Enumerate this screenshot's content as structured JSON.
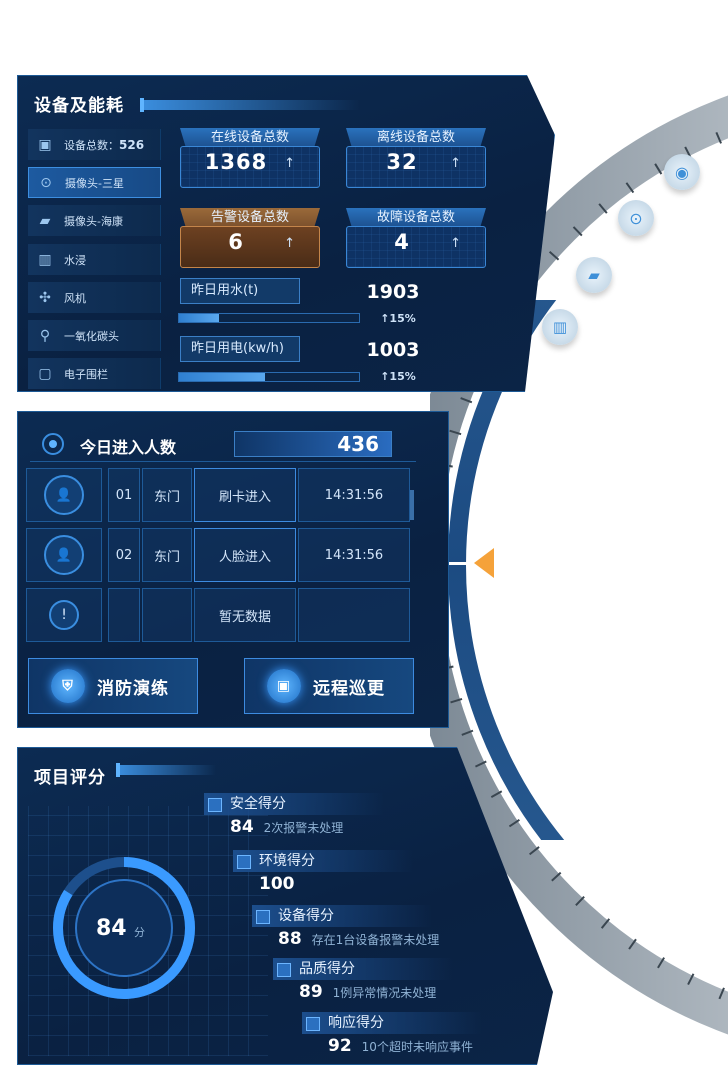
{
  "device_panel": {
    "title": "设备及能耗",
    "device_list": [
      {
        "label": "设备总数：",
        "value": "526",
        "icon": "device-icon"
      },
      {
        "label": "摄像头-三星",
        "icon": "camera-icon"
      },
      {
        "label": "摄像头-海康",
        "icon": "cctv-icon"
      },
      {
        "label": "水浸",
        "icon": "water-icon"
      },
      {
        "label": "风机",
        "icon": "fan-icon"
      },
      {
        "label": "一氧化碳头",
        "icon": "co-sensor-icon"
      },
      {
        "label": "电子围栏",
        "icon": "fence-icon"
      }
    ],
    "stats": [
      {
        "label": "在线设备总数",
        "value": "1368"
      },
      {
        "label": "离线设备总数",
        "value": "32"
      },
      {
        "label": "告警设备总数",
        "value": "6"
      },
      {
        "label": "故障设备总数",
        "value": "4"
      }
    ],
    "up_arrow": "↑",
    "water": {
      "label": "昨日用水(t)",
      "value": "1903",
      "change": "↑15%",
      "level": 0.22
    },
    "power": {
      "label": "昨日用电(kw/h)",
      "value": "1003",
      "change": "↑15%",
      "level": 0.48
    }
  },
  "entry_panel": {
    "title": "今日进入人数",
    "count": "436",
    "rows": [
      {
        "no": "01",
        "gate": "东门",
        "method": "刷卡进入",
        "time": "14:31:56"
      },
      {
        "no": "02",
        "gate": "东门",
        "method": "人脸进入",
        "time": "14:31:56"
      },
      {
        "no": "",
        "gate": "",
        "method": "暂无数据",
        "time": ""
      }
    ],
    "buttons": {
      "fire_drill": "消防演练",
      "remote_patrol": "远程巡更"
    }
  },
  "score_panel": {
    "title": "项目评分",
    "total": "84",
    "unit": "分",
    "items": [
      {
        "name": "安全得分",
        "score": "84",
        "note": "2次报警未处理"
      },
      {
        "name": "环境得分",
        "score": "100",
        "note": ""
      },
      {
        "name": "设备得分",
        "score": "88",
        "note": "存在1台设备报警未处理"
      },
      {
        "name": "品质得分",
        "score": "89",
        "note": "1例异常情况未处理"
      },
      {
        "name": "响应得分",
        "score": "92",
        "note": "10个超时未响应事件"
      }
    ]
  },
  "colors": {
    "accent": "#3a8ee0",
    "warning": "#c4854a",
    "ring_gray": "#9aa7b2",
    "pointer": "#f5a23a"
  }
}
